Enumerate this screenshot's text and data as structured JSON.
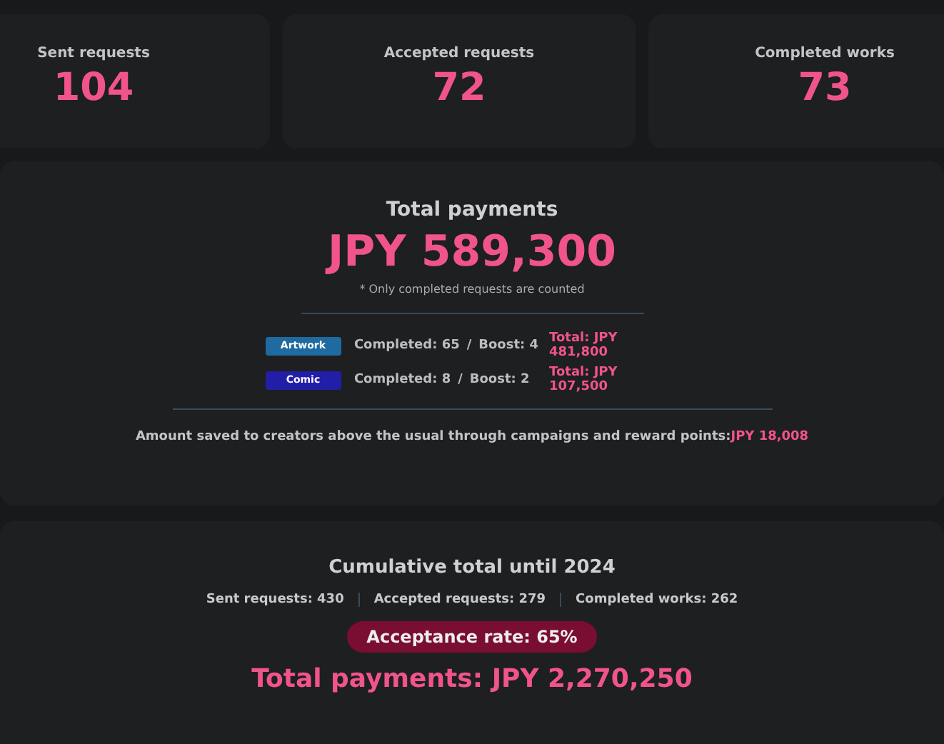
{
  "stats": [
    {
      "label": "Sent requests",
      "value": "104"
    },
    {
      "label": "Accepted requests",
      "value": "72"
    },
    {
      "label": "Completed works",
      "value": "73"
    }
  ],
  "payments": {
    "title": "Total payments",
    "amount": "JPY 589,300",
    "note": "* Only completed requests are counted",
    "categories": [
      {
        "tag": "Artwork",
        "color": "#1f6aa0",
        "completed": "Completed: 65",
        "boost": "Boost: 4",
        "total": "Total: JPY 481,800"
      },
      {
        "tag": "Comic",
        "color": "#221ea8",
        "completed": "Completed: 8",
        "boost": "Boost: 2",
        "total": "Total: JPY 107,500"
      }
    ],
    "separator": "/",
    "savings_label": "Amount saved to creators above the usual through campaigns and reward points:",
    "savings_value": "JPY 18,008"
  },
  "cumulative": {
    "title": "Cumulative total until 2024",
    "stats": [
      "Sent requests: 430",
      "Accepted requests: 279",
      "Completed works: 262"
    ],
    "acceptance_rate": "Acceptance rate: 65%",
    "total": "Total payments: JPY 2,270,250"
  }
}
